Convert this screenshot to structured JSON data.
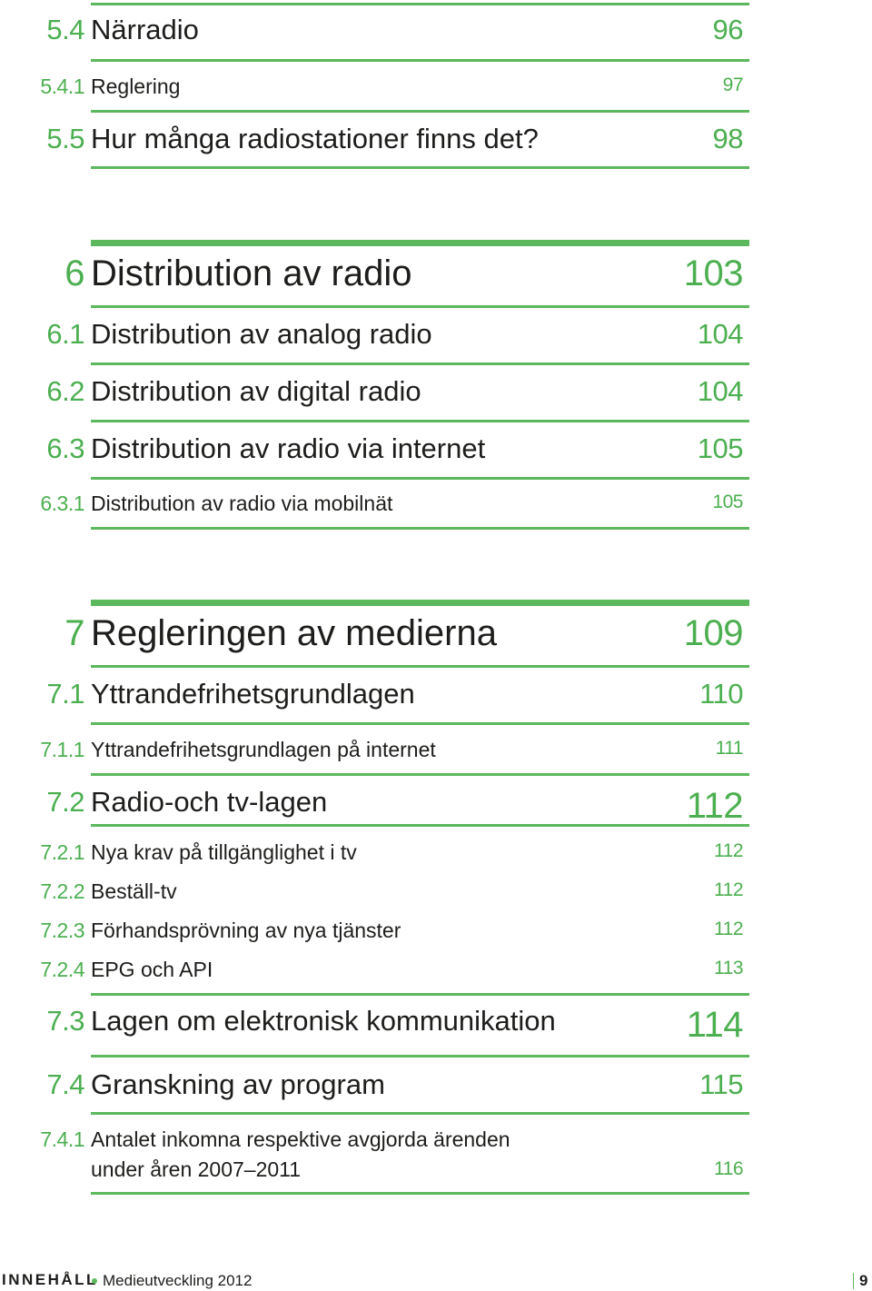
{
  "document": {
    "type": "table-of-contents",
    "accent_color": "#4caf50",
    "entries": [
      {
        "number": "5.4",
        "title": "Närradio",
        "page": "96",
        "level": 2
      },
      {
        "number": "5.4.1",
        "title": "Reglering",
        "page": "97",
        "level": 3
      },
      {
        "number": "5.5",
        "title": "Hur många radiostationer finns det?",
        "page": "98",
        "level": 2
      },
      {
        "number": "6",
        "title": "Distribution av radio",
        "page": "103",
        "level": 1
      },
      {
        "number": "6.1",
        "title": "Distribution av analog radio",
        "page": "104",
        "level": 2
      },
      {
        "number": "6.2",
        "title": "Distribution av digital radio",
        "page": "104",
        "level": 2
      },
      {
        "number": "6.3",
        "title": "Distribution av radio via internet",
        "page": "105",
        "level": 2
      },
      {
        "number": "6.3.1",
        "title": "Distribution av radio via mobilnät",
        "page": "105",
        "level": 3
      },
      {
        "number": "7",
        "title": "Regleringen av medierna",
        "page": "109",
        "level": 1
      },
      {
        "number": "7.1",
        "title": "Yttrandefrihetsgrundlagen",
        "page": "110",
        "level": 2
      },
      {
        "number": "7.1.1",
        "title": "Yttrandefrihetsgrundlagen på internet",
        "page": "111",
        "level": 3
      },
      {
        "number": "7.2",
        "title": "Radio-och tv-lagen",
        "page": "112",
        "level": 2
      },
      {
        "number": "7.2.1",
        "title": "Nya krav på tillgänglighet i tv",
        "page": "112",
        "level": 3
      },
      {
        "number": "7.2.2",
        "title": "Beställ-tv",
        "page": "112",
        "level": 3
      },
      {
        "number": "7.2.3",
        "title": "Förhandsprövning av nya tjänster",
        "page": "112",
        "level": 3
      },
      {
        "number": "7.2.4",
        "title": "EPG och API",
        "page": "113",
        "level": 3
      },
      {
        "number": "7.3",
        "title": "Lagen om elektronisk kommunikation",
        "page": "114",
        "level": 2
      },
      {
        "number": "7.4",
        "title": "Granskning av program",
        "page": "115",
        "level": 2
      },
      {
        "number": "7.4.1",
        "title_line1": "Antalet inkomna respektive avgjorda ärenden",
        "title_line2": "under åren 2007–2011",
        "page": "116",
        "level": 3
      }
    ]
  },
  "footer": {
    "section_label": "INNEHÅLL",
    "separator_icon": "bullet-dot",
    "publication": "Medieutveckling 2012",
    "page_number": "9"
  }
}
